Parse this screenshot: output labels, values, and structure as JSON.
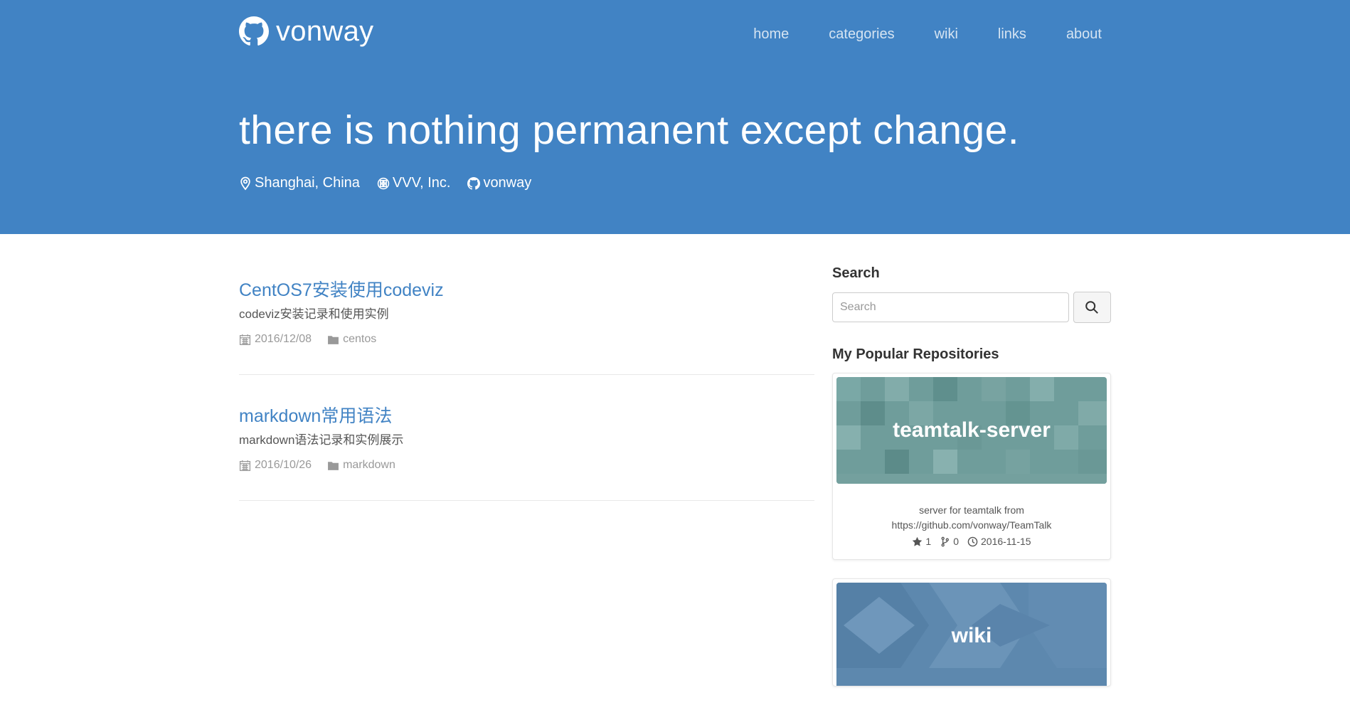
{
  "brand": {
    "name": "vonway",
    "icon": "github-icon"
  },
  "nav": [
    {
      "label": "home"
    },
    {
      "label": "categories"
    },
    {
      "label": "wiki"
    },
    {
      "label": "links"
    },
    {
      "label": "about"
    }
  ],
  "hero": {
    "tagline": "there is nothing permanent except change.",
    "location": "Shanghai, China",
    "company": "VVV, Inc.",
    "github": "vonway"
  },
  "posts": [
    {
      "title": "CentOS7安装使用codeviz",
      "description": "codeviz安装记录和使用实例",
      "date": "2016/12/08",
      "category": "centos"
    },
    {
      "title": "markdown常用语法",
      "description": "markdown语法记录和实例展示",
      "date": "2016/10/26",
      "category": "markdown"
    }
  ],
  "sidebar": {
    "search_heading": "Search",
    "search_placeholder": "Search",
    "repos_heading": "My Popular Repositories",
    "repos": [
      {
        "name": "teamtalk-server",
        "description_line1": "server for teamtalk from",
        "description_line2": "https://github.com/vonway/TeamTalk",
        "stars": "1",
        "forks": "0",
        "updated": "2016-11-15"
      },
      {
        "name": "wiki"
      }
    ]
  },
  "colors": {
    "header_bg": "#4183c4",
    "link": "#4183c4",
    "repo1_banner": "#6a9a9a",
    "repo2_banner": "#5b86ad"
  }
}
